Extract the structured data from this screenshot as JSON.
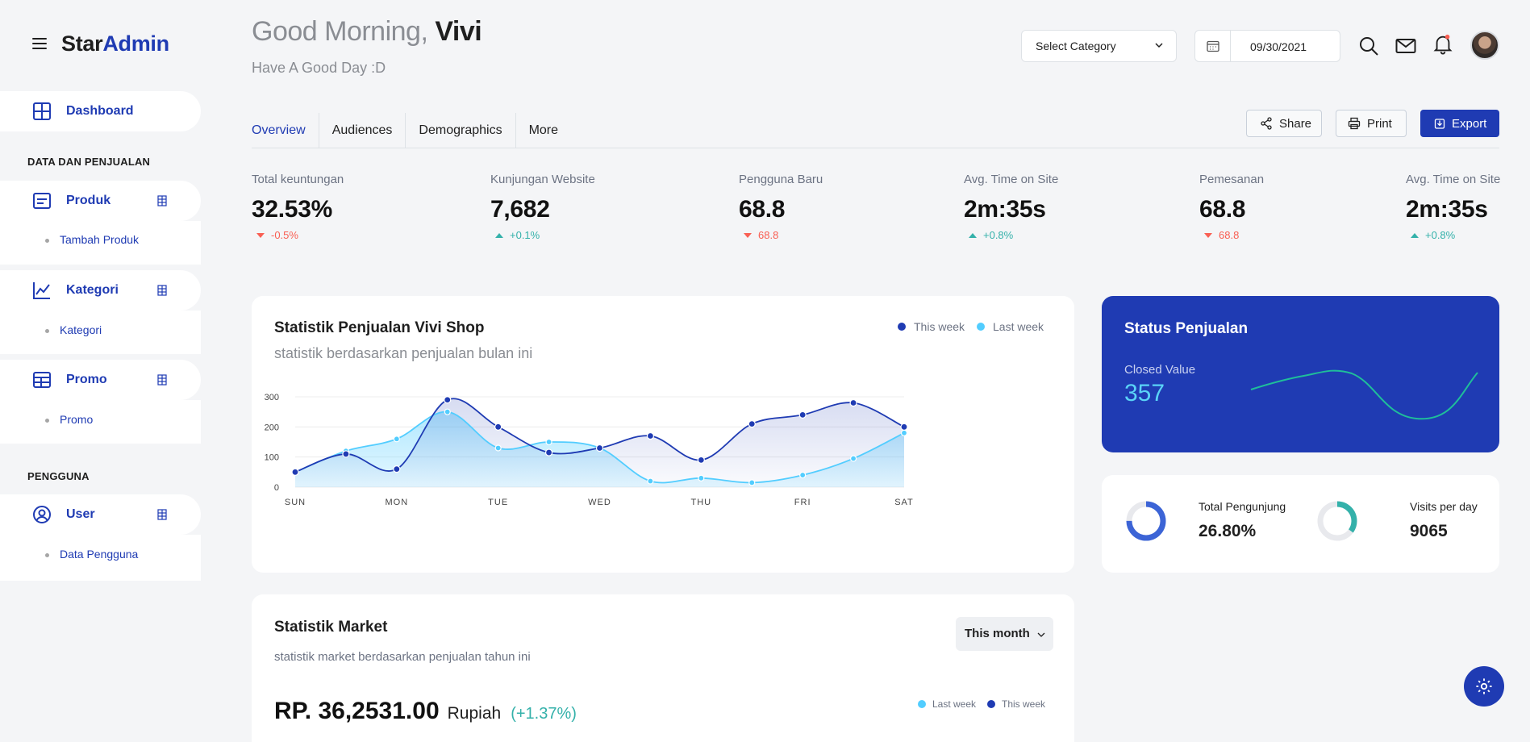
{
  "brand": {
    "part1": "Star",
    "part2": "Admin"
  },
  "sidebar": {
    "dashboard": "Dashboard",
    "section1": "DATA DAN PENJUALAN",
    "groups": [
      {
        "label": "Produk",
        "sub": "Tambah Produk"
      },
      {
        "label": "Kategori",
        "sub": "Kategori"
      },
      {
        "label": "Promo",
        "sub": "Promo"
      }
    ],
    "section2": "PENGGUNA",
    "user": {
      "label": "User",
      "sub": "Data Pengguna"
    }
  },
  "header": {
    "greeting": "Good Morning,",
    "name": "Vivi",
    "subtitle": "Have A Good Day :D",
    "select_label": "Select Category",
    "date": "09/30/2021"
  },
  "tabs": [
    "Overview",
    "Audiences",
    "Demographics",
    "More"
  ],
  "actions": {
    "share": "Share",
    "print": "Print",
    "export": "Export"
  },
  "stats": [
    {
      "title": "Total keuntungan",
      "value": "32.53%",
      "delta": "-0.5%",
      "dir": "down"
    },
    {
      "title": "Kunjungan Website",
      "value": "7,682",
      "delta": "+0.1%",
      "dir": "up"
    },
    {
      "title": "Pengguna Baru",
      "value": "68.8",
      "delta": "68.8",
      "dir": "down"
    },
    {
      "title": "Avg. Time on Site",
      "value": "2m:35s",
      "delta": "+0.8%",
      "dir": "up"
    },
    {
      "title": "Pemesanan",
      "value": "68.8",
      "delta": "68.8",
      "dir": "down"
    },
    {
      "title": "Avg. Time on Site",
      "value": "2m:35s",
      "delta": "+0.8%",
      "dir": "up"
    }
  ],
  "sales_chart": {
    "title": "Statistik Penjualan Vivi Shop",
    "subtitle": "statistik berdasarkan penjualan bulan ini",
    "legend_this": "This week",
    "legend_last": "Last week"
  },
  "chart_data": {
    "type": "area",
    "categories": [
      "SUN",
      "MON",
      "TUE",
      "WED",
      "THU",
      "FRI",
      "SAT"
    ],
    "yticks": [
      0,
      100,
      200,
      300
    ],
    "ylim": [
      0,
      300
    ],
    "x": [
      0,
      0.5,
      1,
      1.5,
      2,
      2.5,
      3,
      3.5,
      4,
      4.5,
      5,
      5.5,
      6
    ],
    "series": [
      {
        "name": "This week",
        "color": "#1f3bb3",
        "values": [
          50,
          110,
          60,
          290,
          200,
          115,
          130,
          170,
          90,
          210,
          240,
          280,
          200
        ]
      },
      {
        "name": "Last week",
        "color": "#52cdff",
        "values": [
          50,
          120,
          160,
          250,
          130,
          150,
          130,
          20,
          30,
          15,
          40,
          95,
          180
        ]
      }
    ]
  },
  "status": {
    "title": "Status Penjualan",
    "label": "Closed Value",
    "value": "357"
  },
  "visitors": {
    "total_label": "Total Pengunjung",
    "total_value": "26.80%",
    "total_fraction": 0.75,
    "perday_label": "Visits per day",
    "perday_value": "9065",
    "perday_fraction": 0.35
  },
  "market": {
    "title": "Statistik Market",
    "subtitle": "statistik market berdasarkan penjualan tahun ini",
    "filter": "This month",
    "amount": "RP. 36,2531.00",
    "currency": "Rupiah",
    "change": "(+1.37%)",
    "legend_last": "Last week",
    "legend_this": "This week"
  },
  "colors": {
    "primary": "#1f3bb3",
    "cyan": "#52cdff",
    "teal": "#34b1aa",
    "red": "#f95f53"
  }
}
